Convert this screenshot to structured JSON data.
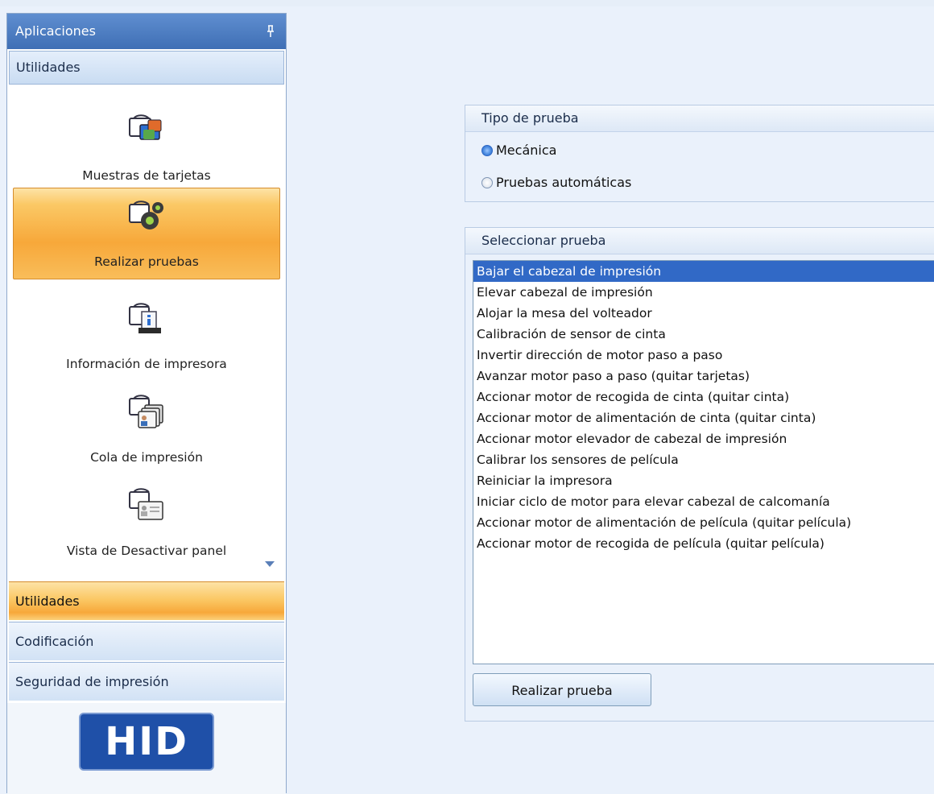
{
  "sidebar": {
    "title": "Aplicaciones",
    "group_header": "Utilidades",
    "tiles": [
      {
        "label": "Muestras de tarjetas",
        "icon": "card-samples-icon"
      },
      {
        "label": "Realizar pruebas",
        "icon": "card-gear-icon"
      },
      {
        "label": "Información de impresora",
        "icon": "card-info-icon"
      },
      {
        "label": "Cola de impresión",
        "icon": "card-queue-icon"
      },
      {
        "label": "Vista de Desactivar panel",
        "icon": "card-panel-icon"
      }
    ],
    "bottom_tabs": [
      {
        "label": "Utilidades",
        "active": true
      },
      {
        "label": "Codificación",
        "active": false
      },
      {
        "label": "Seguridad de impresión",
        "active": false
      }
    ],
    "logo_text": "HID"
  },
  "test_type": {
    "title": "Tipo de prueba",
    "options": [
      {
        "label": "Mecánica",
        "checked": true
      },
      {
        "label": "Pruebas automáticas",
        "checked": false
      }
    ]
  },
  "select_test": {
    "title": "Seleccionar prueba",
    "items": [
      "Bajar el cabezal de impresión",
      "Elevar cabezal de impresión",
      "Alojar la mesa del volteador",
      "Calibración de sensor de cinta",
      "Invertir dirección de motor paso a paso",
      "Avanzar motor paso a paso (quitar tarjetas)",
      "Accionar motor de recogida de cinta (quitar cinta)",
      "Accionar motor de alimentación de cinta (quitar cinta)",
      "Accionar motor elevador de cabezal de impresión",
      "Calibrar los sensores de película",
      "Reiniciar la impresora",
      "Iniciar ciclo de motor para elevar cabezal de calcomanía",
      "Accionar motor de alimentación de película (quitar película)",
      "Accionar motor de recogida de película (quitar película)"
    ],
    "selected_index": 0,
    "button_label": "Realizar prueba"
  },
  "colors": {
    "accent_orange": "#f7a83a",
    "selection_blue": "#3169c6",
    "header_blue": "#4f7fc4",
    "logo_blue": "#1f50a8"
  }
}
